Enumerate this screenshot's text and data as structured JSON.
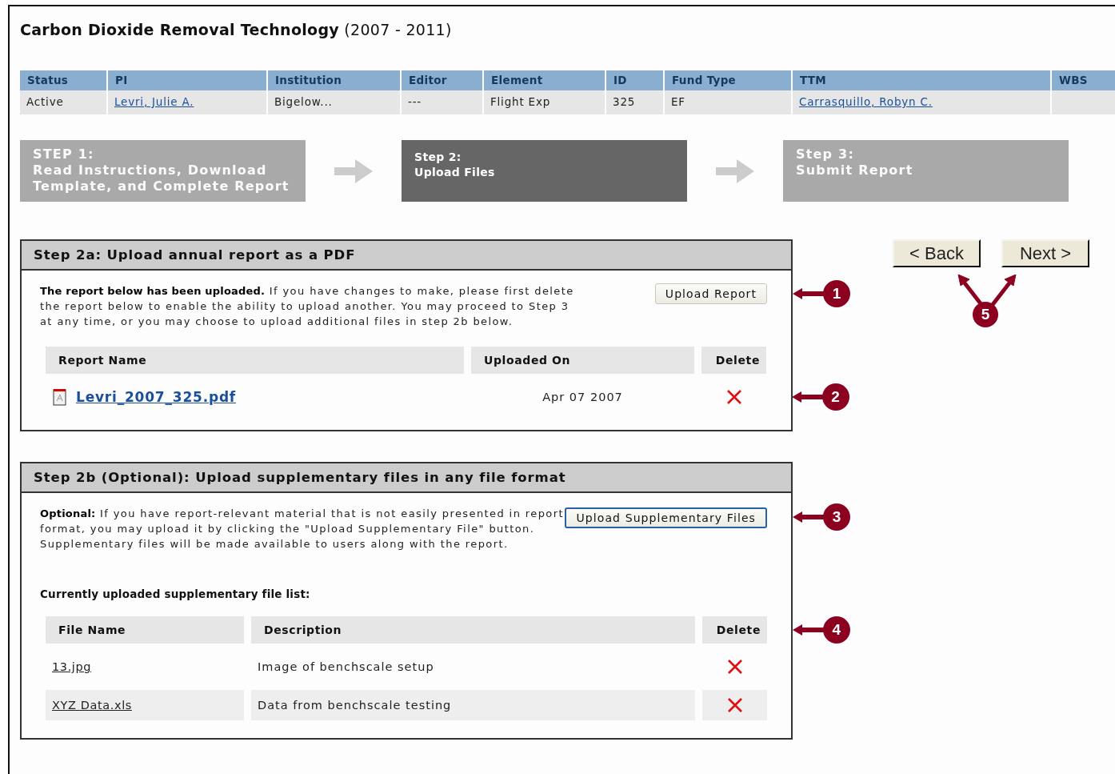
{
  "title": "**Carbon Dioxide Removal Technology** (2007 - 2011)",
  "info_table": {
    "columns": [
      {
        "header": "Status",
        "value": "Active",
        "kind": "text"
      },
      {
        "header": "PI",
        "value": "Levri, Julie A.",
        "kind": "link"
      },
      {
        "header": "Institution",
        "value": "Bigelow...",
        "kind": "text"
      },
      {
        "header": "Editor",
        "value": "---",
        "kind": "text"
      },
      {
        "header": "Element",
        "value": "Flight Exp",
        "kind": "text"
      },
      {
        "header": "ID",
        "value": "325",
        "kind": "text"
      },
      {
        "header": "Fund Type",
        "value": "EF",
        "kind": "text"
      },
      {
        "header": "TTM",
        "value": "Carrasquillo, Robyn C.",
        "kind": "link"
      },
      {
        "header": "WBS"
      }
    ]
  },
  "steps": [
    {
      "label": "STEP 1:",
      "title": "Read Instructions, Download Template, and Complete Report",
      "selected": false
    },
    {
      "label": "Step 2:",
      "title": "Upload Files",
      "selected": true
    },
    {
      "label": "Step 3:",
      "title": "Submit Report",
      "selected": false
    }
  ],
  "panels": [
    {
      "heading": "Step 2a: Upload annual report as a PDF",
      "text": "**The report below has been uploaded.** If you have changes to make, please first delete the report below to enable the ability to upload another. You may proceed to Step 3 at any time, or you may choose to upload additional files in step 2b below.",
      "button": {
        "label": "Upload Report",
        "focused": false,
        "callout": "1"
      },
      "table": {
        "kind": "report",
        "columns": [
          "Report Name",
          "Uploaded On",
          "Delete"
        ],
        "rows": [
          {
            "name": "Levri_2007_325.pdf",
            "cell_2": "Apr 07 2007",
            "callout": "2"
          }
        ]
      }
    },
    {
      "heading": "Step 2b (Optional): Upload supplementary files in any file format",
      "text": "**Optional:** If you have report-relevant material that is not easily presented in report format, you may upload it by clicking the \"Upload Supplementary File\" button. Supplementary files will be made available to users along with the report.",
      "button": {
        "label": "Upload Supplementary Files",
        "focused": true,
        "callout": "3"
      },
      "list_label": "Currently uploaded supplementary file list:",
      "table": {
        "kind": "files",
        "columns": [
          "File Name",
          "Description",
          "Delete"
        ],
        "callout": "4",
        "rows": [
          {
            "name": "13.jpg",
            "cell_2": "Image of benchscale setup"
          },
          {
            "name": "XYZ Data.xls",
            "cell_2": "Data from benchscale testing"
          }
        ]
      }
    }
  ],
  "nav": {
    "buttons": [
      "< Back",
      "Next >"
    ],
    "callout": "5"
  }
}
